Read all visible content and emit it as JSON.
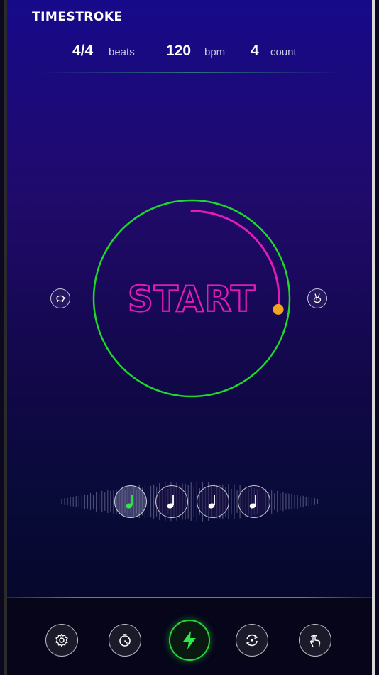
{
  "app": {
    "logo": "TIMESTROKE"
  },
  "stats": {
    "time_signature": "4/4",
    "time_signature_unit": "beats",
    "tempo": "120",
    "tempo_unit": "bpm",
    "count": "4",
    "count_unit": "count"
  },
  "dial": {
    "label": "START",
    "ring_color": "#1fd82c",
    "progress_color": "#e21bb8",
    "handle_color": "#f2a322",
    "progress": 0.27
  },
  "side_buttons": {
    "left_icon": "tortoise-icon",
    "right_icon": "hare-icon"
  },
  "beats": [
    {
      "icon": "quarter-note-icon",
      "active": true
    },
    {
      "icon": "quarter-note-icon",
      "active": false
    },
    {
      "icon": "quarter-note-icon",
      "active": false
    },
    {
      "icon": "quarter-note-icon",
      "active": false
    }
  ],
  "nav": [
    {
      "icon": "gear-icon"
    },
    {
      "icon": "timer-icon"
    },
    {
      "icon": "lightning-icon"
    },
    {
      "icon": "repeat-icon"
    },
    {
      "icon": "tap-hand-icon"
    }
  ],
  "colors": {
    "accent_green": "#28d43a",
    "accent_pink": "#e21bb8"
  }
}
